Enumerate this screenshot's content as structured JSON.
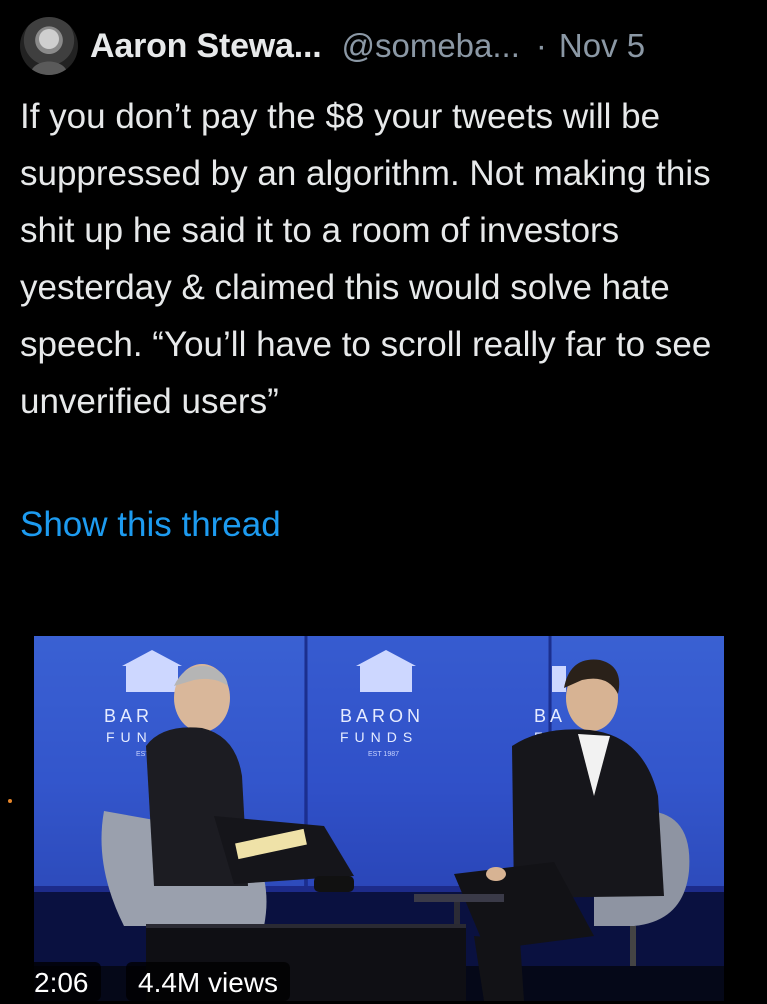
{
  "tweet": {
    "author_name": "Aaron Stewa...",
    "handle": "@someba...",
    "separator": "·",
    "date": "Nov 5",
    "text": "If you don’t pay the $8 your tweets will be suppressed by an algorithm. Not making this shit up he said it to a room of investors yesterday & claimed this would solve hate speech. “You’ll have to scroll really far to see unverified users”",
    "show_thread_label": "Show this thread",
    "link_color": "#1d9bf0"
  },
  "media": {
    "duration": "2:06",
    "views": "4.4M views",
    "backdrop_signs": [
      {
        "line1": "BAR",
        "line2": "FUN",
        "est": "EST"
      },
      {
        "line1": "BARON",
        "line2": "FUNDS",
        "est": "EST 1987"
      },
      {
        "line1": "BA",
        "line2": "FU",
        "est": ""
      }
    ],
    "icons": [
      "person-interviewer-icon",
      "person-interviewee-icon",
      "chair-icon"
    ]
  }
}
